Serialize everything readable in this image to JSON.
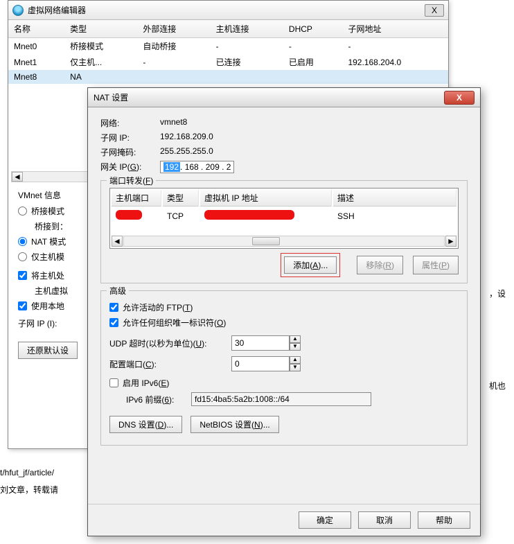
{
  "background": {
    "t1": "t/hfut_jf/article/",
    "t2": "刘文章，转载请",
    "t3": "，设",
    "t4": "机也"
  },
  "win1": {
    "title": "虚拟网络编辑器",
    "close_x": "X",
    "cols": {
      "name": "名称",
      "type": "类型",
      "ext": "外部连接",
      "host": "主机连接",
      "dhcp": "DHCP",
      "subnet": "子网地址"
    },
    "rows": [
      {
        "name": "Mnet0",
        "type": "桥接模式",
        "ext": "自动桥接",
        "host": "-",
        "dhcp": "-",
        "subnet": "-"
      },
      {
        "name": "Mnet1",
        "type": "仅主机...",
        "ext": "-",
        "host": "已连接",
        "dhcp": "已启用",
        "subnet": "192.168.204.0"
      },
      {
        "name": "Mnet8",
        "type": "NA",
        "ext": "",
        "host": "",
        "dhcp": "",
        "subnet": ""
      }
    ],
    "info_header": "VMnet 信息",
    "radio_bridge": "桥接模式",
    "bridge_to": "桥接到：",
    "radio_nat": "NAT 模式",
    "radio_host": "仅主机模",
    "chk_host_conn": "将主机处",
    "host_vnic": "主机虚拟",
    "chk_local": "使用本地",
    "subnet_ip_label": "子网 IP (I):",
    "restore_btn": "还原默认设"
  },
  "win2": {
    "title": "NAT 设置",
    "close_x": "X",
    "net_label": "网络:",
    "net_val": "vmnet8",
    "subnet_label": "子网 IP:",
    "subnet_val": "192.168.209.0",
    "mask_label": "子网掩码:",
    "mask_val": "255.255.255.0",
    "gw_label": "网关 IP(G):",
    "gw_oct1": "192",
    "gw_rest": ". 168 . 209 .   2",
    "pf_legend": "端口转发(F)",
    "pf_cols": {
      "hostport": "主机端口",
      "type": "类型",
      "vmip": "虚拟机 IP 地址",
      "desc": "描述"
    },
    "pf_row": {
      "type": "TCP",
      "desc": "SSH"
    },
    "btn_add": "添加(A)...",
    "btn_remove": "移除(R)",
    "btn_props": "属性(P)",
    "adv_legend": "高级",
    "chk_ftp": "允许活动的 FTP(T)",
    "chk_org": "允许任何组织唯一标识符(O)",
    "udp_label": "UDP 超时(以秒为单位)(U):",
    "udp_val": "30",
    "cfg_port_label": "配置端口(C):",
    "cfg_port_val": "0",
    "chk_ipv6": "启用 IPv6(E)",
    "ipv6_prefix_label": "IPv6 前缀(6):",
    "ipv6_prefix_val": "fd15:4ba5:5a2b:1008::/64",
    "btn_dns": "DNS 设置(D)...",
    "btn_netbios": "NetBIOS 设置(N)...",
    "btn_ok": "确定",
    "btn_cancel": "取消",
    "btn_help": "帮助"
  }
}
